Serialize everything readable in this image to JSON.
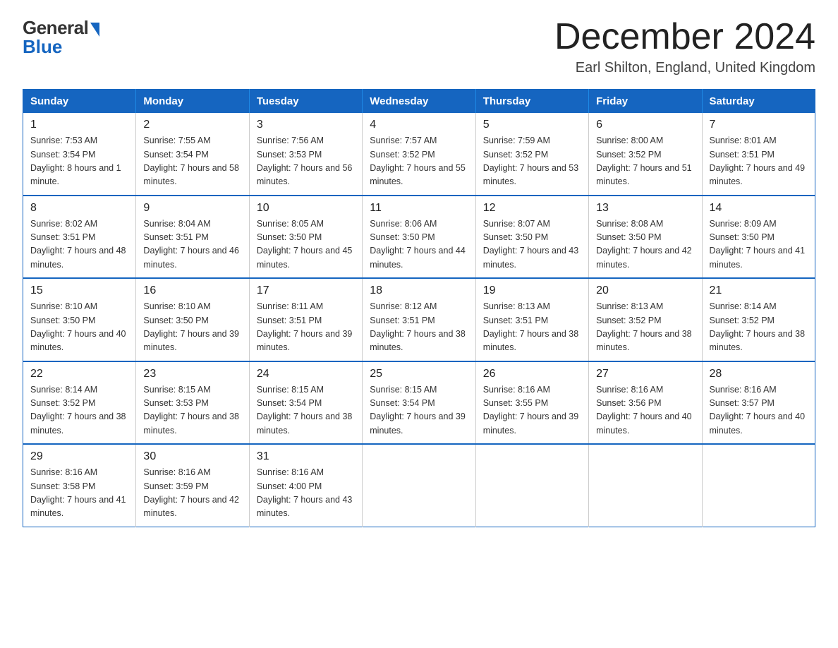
{
  "header": {
    "logo_general": "General",
    "logo_blue": "Blue",
    "title": "December 2024",
    "subtitle": "Earl Shilton, England, United Kingdom"
  },
  "weekdays": [
    "Sunday",
    "Monday",
    "Tuesday",
    "Wednesday",
    "Thursday",
    "Friday",
    "Saturday"
  ],
  "weeks": [
    [
      {
        "day": "1",
        "sunrise": "7:53 AM",
        "sunset": "3:54 PM",
        "daylight": "8 hours and 1 minute."
      },
      {
        "day": "2",
        "sunrise": "7:55 AM",
        "sunset": "3:54 PM",
        "daylight": "7 hours and 58 minutes."
      },
      {
        "day": "3",
        "sunrise": "7:56 AM",
        "sunset": "3:53 PM",
        "daylight": "7 hours and 56 minutes."
      },
      {
        "day": "4",
        "sunrise": "7:57 AM",
        "sunset": "3:52 PM",
        "daylight": "7 hours and 55 minutes."
      },
      {
        "day": "5",
        "sunrise": "7:59 AM",
        "sunset": "3:52 PM",
        "daylight": "7 hours and 53 minutes."
      },
      {
        "day": "6",
        "sunrise": "8:00 AM",
        "sunset": "3:52 PM",
        "daylight": "7 hours and 51 minutes."
      },
      {
        "day": "7",
        "sunrise": "8:01 AM",
        "sunset": "3:51 PM",
        "daylight": "7 hours and 49 minutes."
      }
    ],
    [
      {
        "day": "8",
        "sunrise": "8:02 AM",
        "sunset": "3:51 PM",
        "daylight": "7 hours and 48 minutes."
      },
      {
        "day": "9",
        "sunrise": "8:04 AM",
        "sunset": "3:51 PM",
        "daylight": "7 hours and 46 minutes."
      },
      {
        "day": "10",
        "sunrise": "8:05 AM",
        "sunset": "3:50 PM",
        "daylight": "7 hours and 45 minutes."
      },
      {
        "day": "11",
        "sunrise": "8:06 AM",
        "sunset": "3:50 PM",
        "daylight": "7 hours and 44 minutes."
      },
      {
        "day": "12",
        "sunrise": "8:07 AM",
        "sunset": "3:50 PM",
        "daylight": "7 hours and 43 minutes."
      },
      {
        "day": "13",
        "sunrise": "8:08 AM",
        "sunset": "3:50 PM",
        "daylight": "7 hours and 42 minutes."
      },
      {
        "day": "14",
        "sunrise": "8:09 AM",
        "sunset": "3:50 PM",
        "daylight": "7 hours and 41 minutes."
      }
    ],
    [
      {
        "day": "15",
        "sunrise": "8:10 AM",
        "sunset": "3:50 PM",
        "daylight": "7 hours and 40 minutes."
      },
      {
        "day": "16",
        "sunrise": "8:10 AM",
        "sunset": "3:50 PM",
        "daylight": "7 hours and 39 minutes."
      },
      {
        "day": "17",
        "sunrise": "8:11 AM",
        "sunset": "3:51 PM",
        "daylight": "7 hours and 39 minutes."
      },
      {
        "day": "18",
        "sunrise": "8:12 AM",
        "sunset": "3:51 PM",
        "daylight": "7 hours and 38 minutes."
      },
      {
        "day": "19",
        "sunrise": "8:13 AM",
        "sunset": "3:51 PM",
        "daylight": "7 hours and 38 minutes."
      },
      {
        "day": "20",
        "sunrise": "8:13 AM",
        "sunset": "3:52 PM",
        "daylight": "7 hours and 38 minutes."
      },
      {
        "day": "21",
        "sunrise": "8:14 AM",
        "sunset": "3:52 PM",
        "daylight": "7 hours and 38 minutes."
      }
    ],
    [
      {
        "day": "22",
        "sunrise": "8:14 AM",
        "sunset": "3:52 PM",
        "daylight": "7 hours and 38 minutes."
      },
      {
        "day": "23",
        "sunrise": "8:15 AM",
        "sunset": "3:53 PM",
        "daylight": "7 hours and 38 minutes."
      },
      {
        "day": "24",
        "sunrise": "8:15 AM",
        "sunset": "3:54 PM",
        "daylight": "7 hours and 38 minutes."
      },
      {
        "day": "25",
        "sunrise": "8:15 AM",
        "sunset": "3:54 PM",
        "daylight": "7 hours and 39 minutes."
      },
      {
        "day": "26",
        "sunrise": "8:16 AM",
        "sunset": "3:55 PM",
        "daylight": "7 hours and 39 minutes."
      },
      {
        "day": "27",
        "sunrise": "8:16 AM",
        "sunset": "3:56 PM",
        "daylight": "7 hours and 40 minutes."
      },
      {
        "day": "28",
        "sunrise": "8:16 AM",
        "sunset": "3:57 PM",
        "daylight": "7 hours and 40 minutes."
      }
    ],
    [
      {
        "day": "29",
        "sunrise": "8:16 AM",
        "sunset": "3:58 PM",
        "daylight": "7 hours and 41 minutes."
      },
      {
        "day": "30",
        "sunrise": "8:16 AM",
        "sunset": "3:59 PM",
        "daylight": "7 hours and 42 minutes."
      },
      {
        "day": "31",
        "sunrise": "8:16 AM",
        "sunset": "4:00 PM",
        "daylight": "7 hours and 43 minutes."
      },
      null,
      null,
      null,
      null
    ]
  ]
}
